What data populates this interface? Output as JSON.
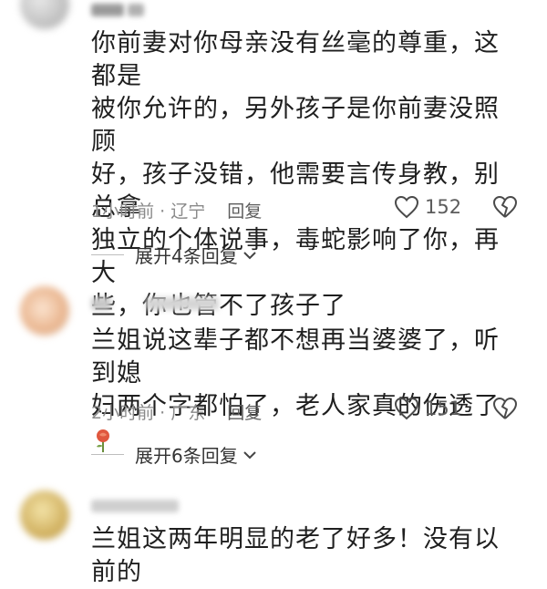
{
  "comments": [
    {
      "text": "你前妻对你母亲没有丝毫的尊重，这都是被你允许的，另外孩子是你前妻没照顾好，孩子没错，他需要言传身教，别总拿独立的个体说事，毒蛇影响了你，再大些，你也管不了孩子了",
      "lines": [
        "你前妻对你母亲没有丝毫的尊重，这都是",
        "被你允许的，另外孩子是你前妻没照顾",
        "好，孩子没错，他需要言传身教，别总拿",
        "独立的个体说事，毒蛇影响了你，再大",
        "些，你也管不了孩子了"
      ],
      "time_location": "1小时前 · 辽宁",
      "reply_label": "回复",
      "likes": "152",
      "expand_label": "展开4条回复",
      "avatar_color": "#c9c9c9"
    },
    {
      "lines": [
        "兰姐说这辈子都不想再当婆婆了，听到媳",
        "妇两个字都怕了，老人家真的伤透了"
      ],
      "emoji": "rose-icon",
      "time_location": "2小时前 · 广东",
      "reply_label": "回复",
      "likes": "151",
      "expand_label": "展开6条回复",
      "avatar_color": "#f0c9a8"
    },
    {
      "lines": [
        "兰姐这两年明显的老了好多！没有以前的"
      ],
      "avatar_color": "#d8c27a"
    }
  ]
}
